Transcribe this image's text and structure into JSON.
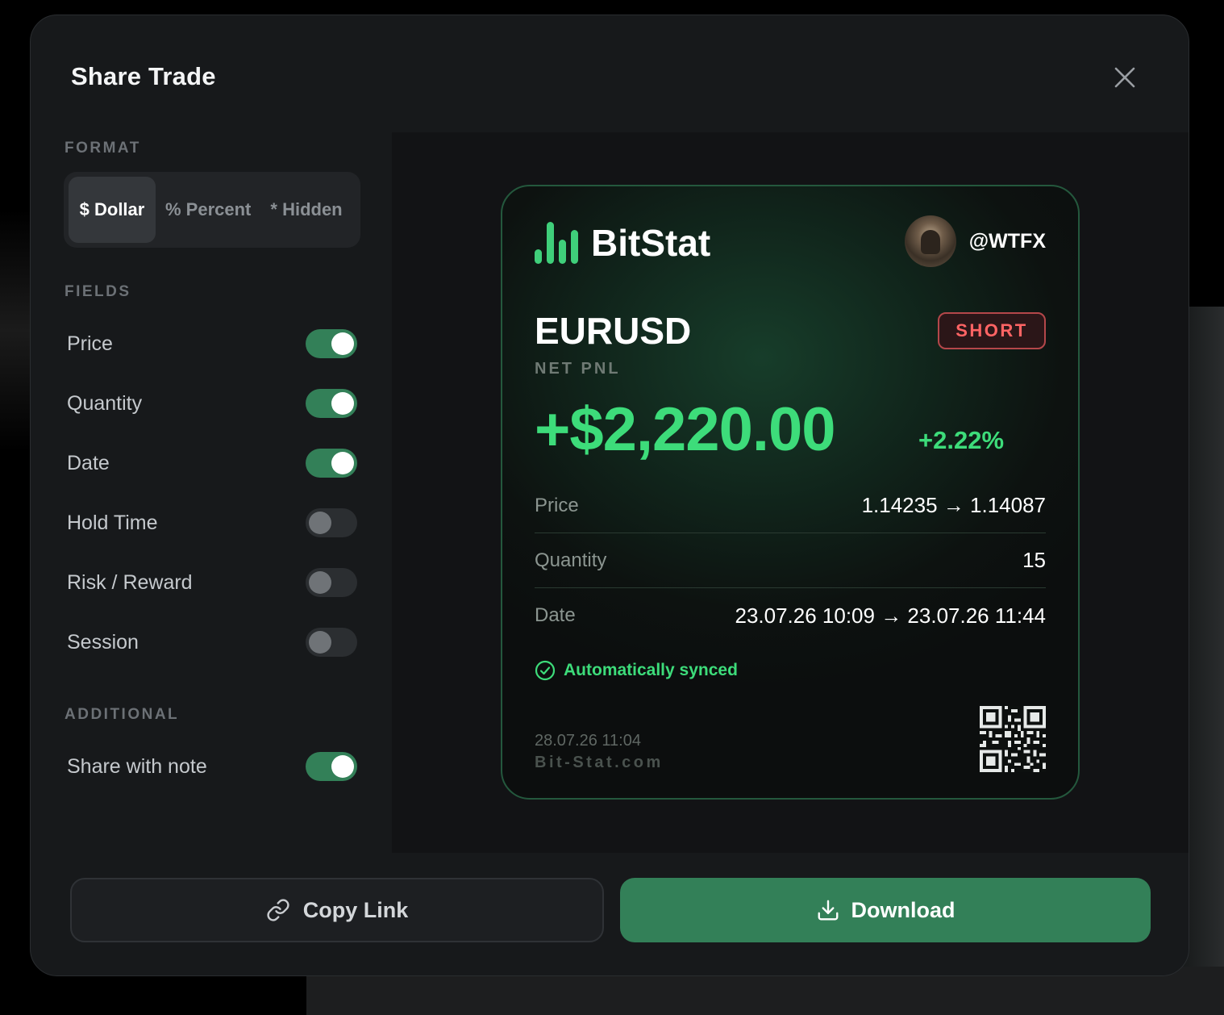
{
  "modal": {
    "title": "Share Trade"
  },
  "format": {
    "section_label": "FORMAT",
    "options": [
      {
        "label": "$ Dollar",
        "active": true
      },
      {
        "label": "% Percent",
        "active": false
      },
      {
        "label": "* Hidden",
        "active": false
      }
    ]
  },
  "fields": {
    "section_label": "FIELDS",
    "items": [
      {
        "label": "Price",
        "on": true
      },
      {
        "label": "Quantity",
        "on": true
      },
      {
        "label": "Date",
        "on": true
      },
      {
        "label": "Hold Time",
        "on": false
      },
      {
        "label": "Risk / Reward",
        "on": false
      },
      {
        "label": "Session",
        "on": false
      }
    ]
  },
  "additional": {
    "section_label": "ADDITIONAL",
    "items": [
      {
        "label": "Share with note",
        "on": true
      }
    ]
  },
  "card": {
    "brand": "BitStat",
    "username": "@WTFX",
    "symbol": "EURUSD",
    "side": "SHORT",
    "pnl_label": "NET PNL",
    "pnl_value": "+$2,220.00",
    "pnl_percent": "+2.22%",
    "rows": [
      {
        "label": "Price",
        "value": "1.14235 → 1.14087"
      },
      {
        "label": "Quantity",
        "value": "15"
      },
      {
        "label": "Date",
        "value": "23.07.26 10:09 → 23.07.26 11:44"
      }
    ],
    "synced_text": "Automatically synced",
    "timestamp": "28.07.26 11:04",
    "site": "Bit-Stat.com"
  },
  "actions": {
    "copy_label": "Copy Link",
    "download_label": "Download"
  },
  "colors": {
    "accent_green": "#338058",
    "pnl_green": "#3ddc7a",
    "short_red": "#ff6464",
    "modal_bg": "#17191b"
  },
  "icons": [
    "close-icon",
    "link-icon",
    "download-icon",
    "check-circle-icon",
    "qr-code-icon",
    "bar-chart-logo-icon"
  ]
}
